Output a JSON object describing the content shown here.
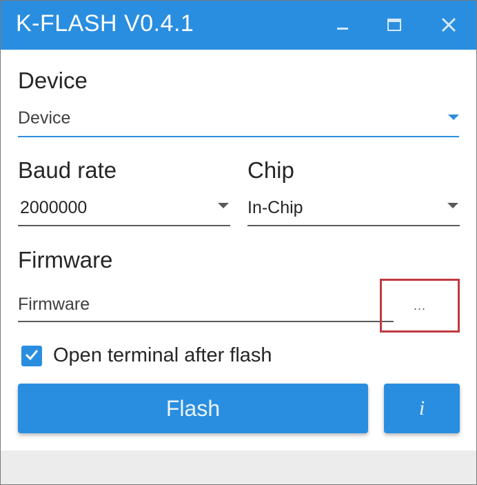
{
  "window": {
    "title": "K-FLASH V0.4.1"
  },
  "device": {
    "label": "Device",
    "placeholder": "Device"
  },
  "baud": {
    "label": "Baud rate",
    "value": "2000000"
  },
  "chip": {
    "label": "Chip",
    "value": "In-Chip"
  },
  "firmware": {
    "label": "Firmware",
    "placeholder": "Firmware",
    "browse_label": "..."
  },
  "terminal_option": {
    "label": "Open terminal after flash",
    "checked": true
  },
  "actions": {
    "flash_label": "Flash",
    "info_label": "i"
  },
  "colors": {
    "accent": "#2a8ee0",
    "highlight": "#c0393f"
  },
  "icons": {
    "minimize": "minimize-icon",
    "maximize": "maximize-icon",
    "close": "close-icon",
    "dropdown": "triangle-down-icon",
    "check": "checkmark-icon"
  }
}
